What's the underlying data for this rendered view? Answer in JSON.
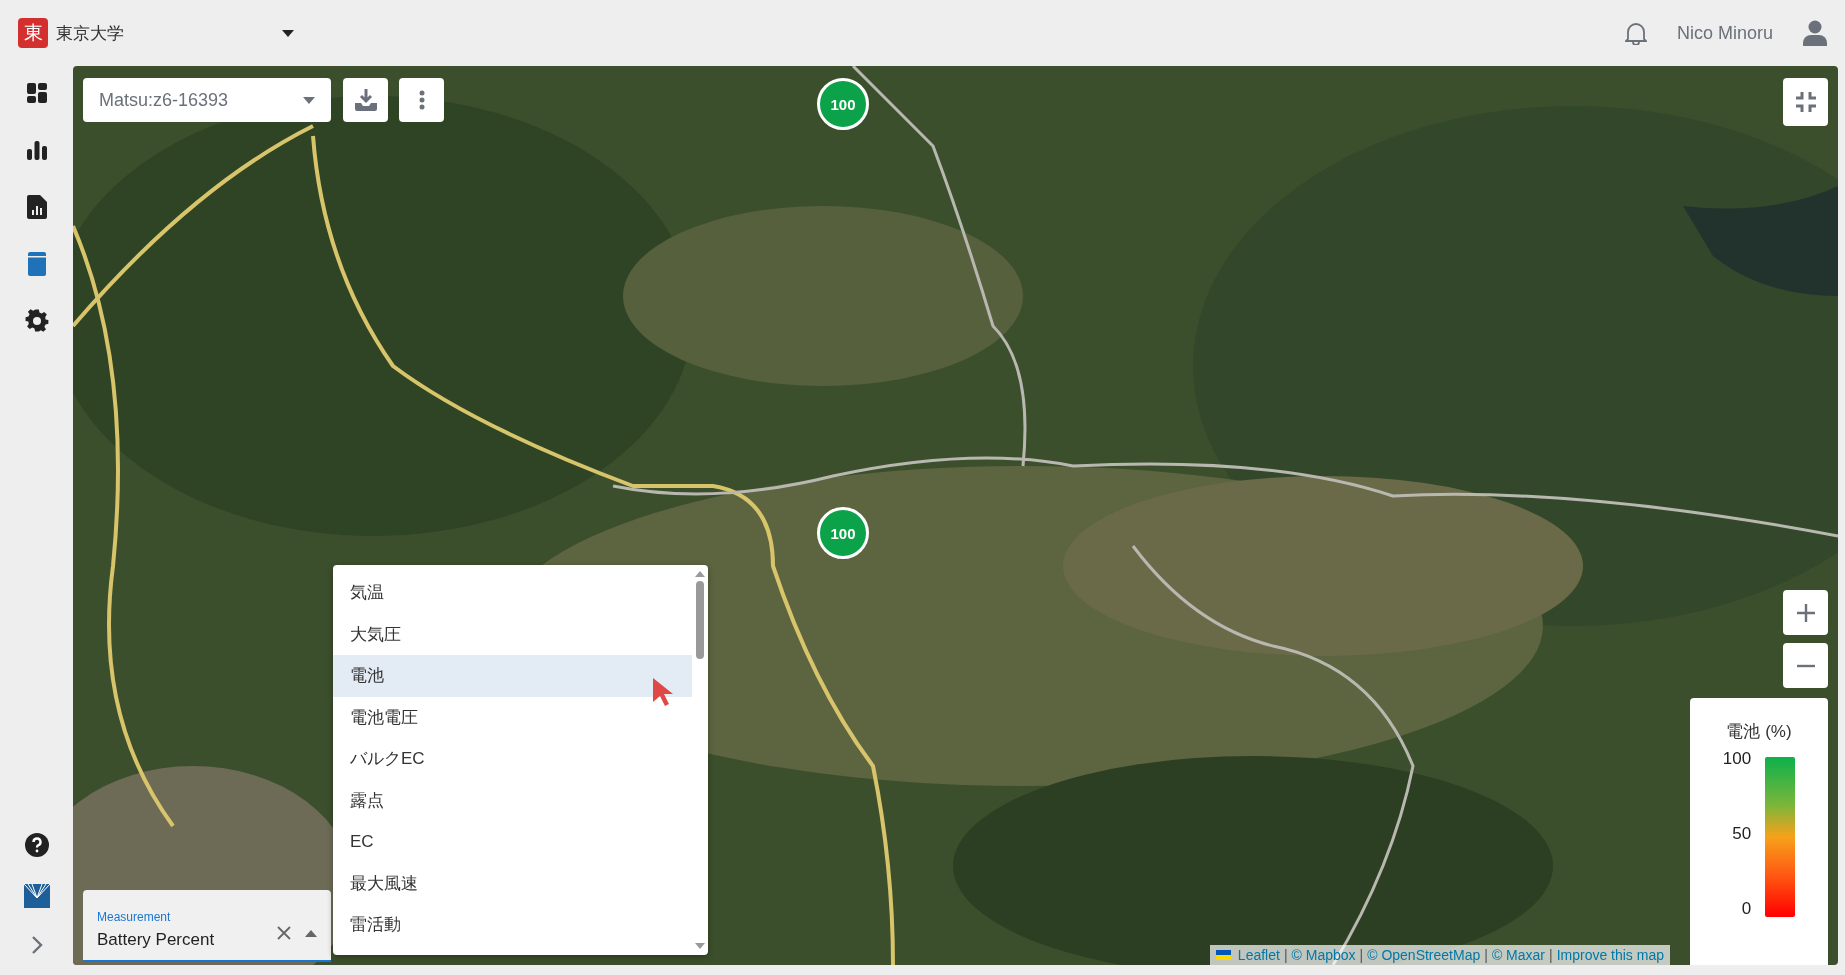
{
  "header": {
    "org_badge": "東",
    "org_name": "東京大学",
    "user_name": "Nico Minoru"
  },
  "sidebar": {
    "items": [
      {
        "kind": "dashboard",
        "selected": false
      },
      {
        "kind": "chart",
        "selected": false
      },
      {
        "kind": "report",
        "selected": false
      },
      {
        "kind": "device",
        "selected": true
      },
      {
        "kind": "settings",
        "selected": false
      }
    ]
  },
  "map": {
    "layer_select": {
      "value": "Matsu:z6-16393"
    },
    "markers": [
      {
        "label": "100"
      },
      {
        "label": "100"
      }
    ],
    "measurement": {
      "label": "Measurement",
      "value": "Battery Percent",
      "expanded": true
    },
    "options": [
      {
        "label": "気温",
        "selected": false
      },
      {
        "label": "大気圧",
        "selected": false
      },
      {
        "label": "電池",
        "selected": true
      },
      {
        "label": "電池電圧",
        "selected": false
      },
      {
        "label": "バルクEC",
        "selected": false
      },
      {
        "label": "露点",
        "selected": false
      },
      {
        "label": "EC",
        "selected": false
      },
      {
        "label": "最大風速",
        "selected": false
      },
      {
        "label": "雷活動",
        "selected": false
      }
    ],
    "legend": {
      "title": "電池 (%)",
      "ticks": [
        "100",
        "50",
        "0"
      ]
    },
    "attribution": {
      "separator": "|",
      "links": [
        "Leaflet",
        "© Mapbox",
        "© OpenStreetMap",
        "© Maxar",
        "Improve this map"
      ]
    }
  }
}
